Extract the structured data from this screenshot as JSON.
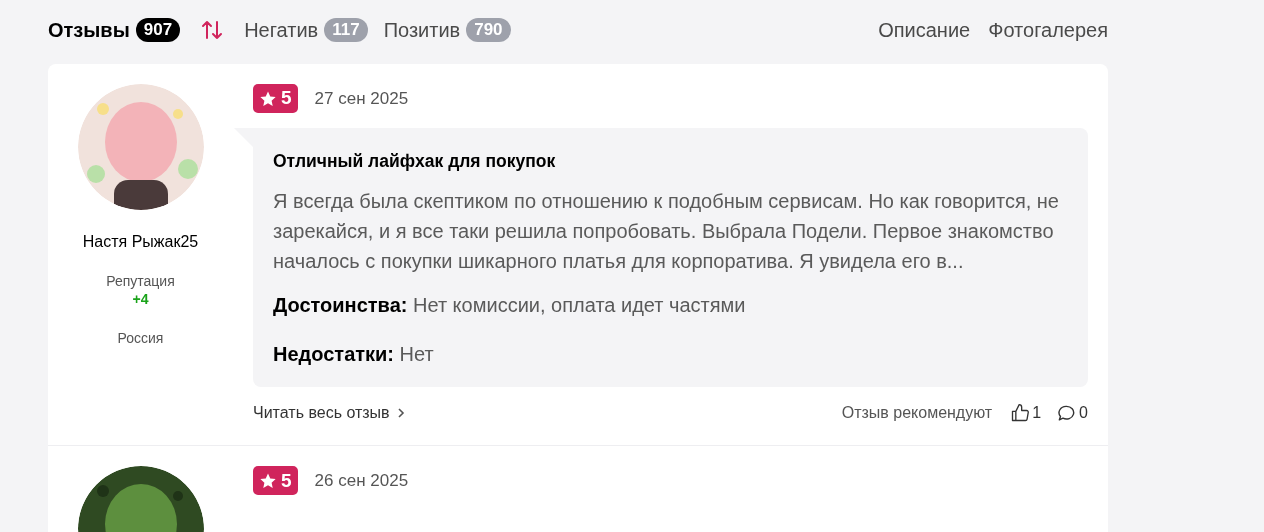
{
  "tabs": [
    {
      "label": "Отзывы",
      "count": "907",
      "selected": true
    },
    {
      "label": "Негатив",
      "count": "117",
      "selected": false
    },
    {
      "label": "Позитив",
      "count": "790",
      "selected": false
    }
  ],
  "nav_links": [
    "Описание",
    "Фотогалерея"
  ],
  "reviews": [
    {
      "author": "Настя Рыжак25",
      "reputation_label": "Репутация",
      "reputation": "+4",
      "country": "Россия",
      "rating": "5",
      "date": "27 сен 2025",
      "title": "Отличный лайфхак для покупок",
      "text": "Я всегда была скептиком по отношению к подобным сервисам. Но как говорится, не зарекайся, и я все таки решила попробовать. Выбрала Подели. Первое знакомство началось с покупки шикарного платья для корпоратива. Я увидела его в...",
      "pros_label": "Достоинства:",
      "pros": "Нет комиссии, оплата идет частями",
      "cons_label": "Недостатки:",
      "cons": "Нет",
      "read_more": "Читать весь отзыв",
      "recommend_label": "Отзыв рекомендуют",
      "likes": "1",
      "comments": "0"
    },
    {
      "rating": "5",
      "date": "26 сен 2025"
    }
  ]
}
